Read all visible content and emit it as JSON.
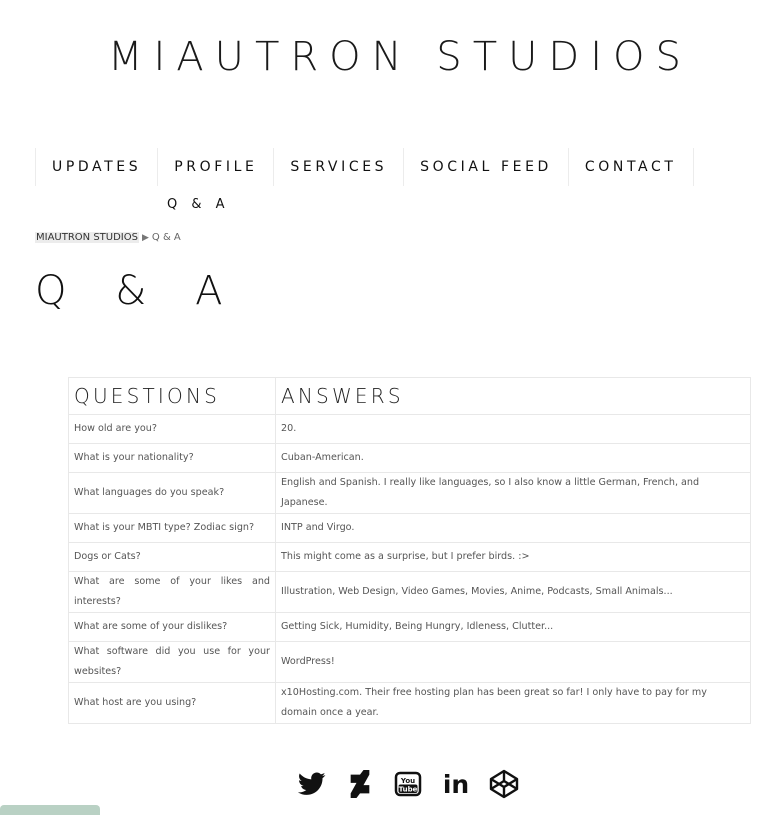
{
  "site_title": "MIAUTRON STUDIOS",
  "nav": {
    "items": [
      "UPDATES",
      "PROFILE",
      "SERVICES",
      "SOCIAL FEED",
      "CONTACT"
    ],
    "sub_item": "Q & A"
  },
  "breadcrumb": {
    "home": "MIAUTRON STUDIOS",
    "separator": "▶",
    "current": "Q & A"
  },
  "page_title": "Q & A",
  "table": {
    "headers": {
      "question": "QUESTIONS",
      "answer": "ANSWERS"
    },
    "rows": [
      {
        "q": "How old are you?",
        "a": "20."
      },
      {
        "q": "What is your nationality?",
        "a": "Cuban-American."
      },
      {
        "q": "What languages do you speak?",
        "a": "English and Spanish. I really like languages, so I also know a little German, French, and Japanese."
      },
      {
        "q": "What is your MBTI type? Zodiac sign?",
        "a": "INTP and Virgo."
      },
      {
        "q": "Dogs or Cats?",
        "a": "This might come as a surprise, but I prefer birds. :>"
      },
      {
        "q": "What are some of your likes and interests?",
        "a": "Illustration, Web Design, Video Games, Movies, Anime, Podcasts, Small Animals..."
      },
      {
        "q": "What are some of your dislikes?",
        "a": "Getting Sick, Humidity, Being Hungry, Idleness, Clutter..."
      },
      {
        "q": "What software did you use for your websites?",
        "a": "WordPress!"
      },
      {
        "q": "What host are you using?",
        "a": "x10Hosting.com. Their free hosting plan has been great so far! I only have to pay for my domain once a year."
      }
    ]
  },
  "social": {
    "youtube_you": "You",
    "youtube_tube": "Tube",
    "linkedin_text": "in",
    "icons": [
      "twitter-icon",
      "deviantart-icon",
      "youtube-icon",
      "linkedin-icon",
      "codepen-icon"
    ]
  },
  "colors": {
    "text": "#111111",
    "muted": "#555555",
    "border": "#e8e8e8",
    "bottom_tab": "#b9d1c4"
  }
}
